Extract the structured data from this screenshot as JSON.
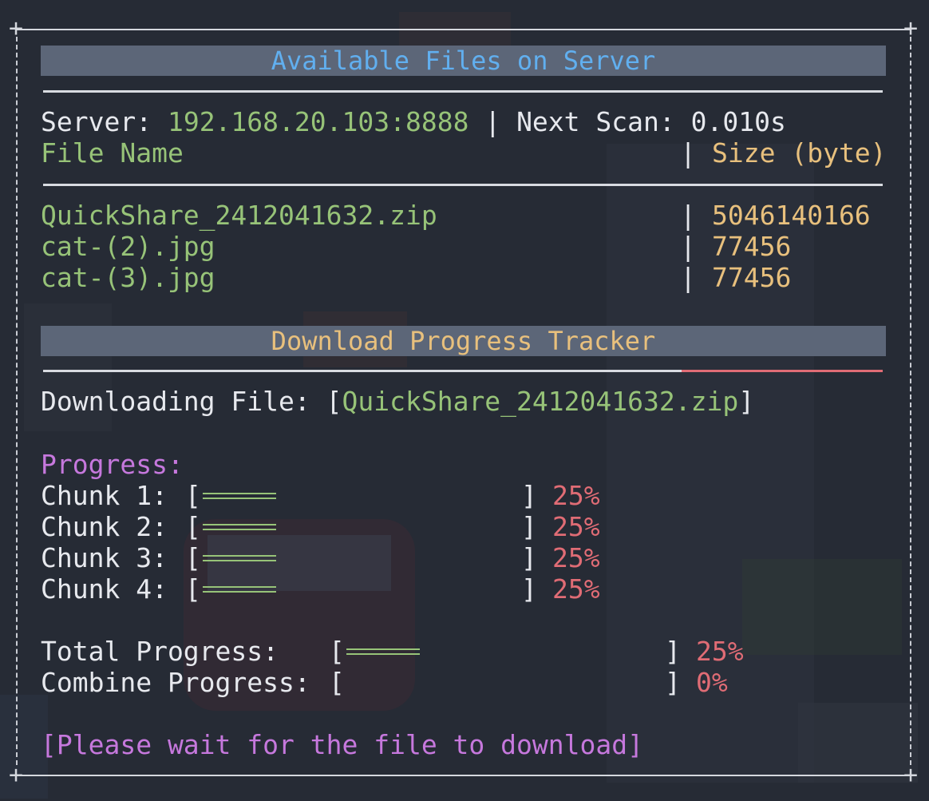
{
  "files_panel": {
    "title": "Available Files on Server",
    "server_label": "Server: ",
    "server_address": "192.168.20.103:8888",
    "separator": " | ",
    "next_scan_label": "Next Scan: ",
    "next_scan_value": "0.010s",
    "columns": {
      "name": "File Name",
      "size": "Size (byte)"
    },
    "column_separator": "|",
    "files": [
      {
        "name": "QuickShare_2412041632.zip",
        "size": "5046140166"
      },
      {
        "name": "cat-(2).jpg",
        "size": "77456"
      },
      {
        "name": "cat-(3).jpg",
        "size": "77456"
      }
    ]
  },
  "download_panel": {
    "title": "Download Progress Tracker",
    "header_progress_fraction": 0.76,
    "downloading_label": "Downloading File: ",
    "bracket_open": "[",
    "bracket_close": "]",
    "downloading_file": "QuickShare_2412041632.zip",
    "progress_heading": "Progress:",
    "chunks": [
      {
        "label": "Chunk 1:",
        "percent_text": "25%",
        "fraction": 0.25
      },
      {
        "label": "Chunk 2:",
        "percent_text": "25%",
        "fraction": 0.25
      },
      {
        "label": "Chunk 3:",
        "percent_text": "25%",
        "fraction": 0.25
      },
      {
        "label": "Chunk 4:",
        "percent_text": "25%",
        "fraction": 0.25
      }
    ],
    "total": {
      "label": "Total Progress:",
      "percent_text": "25%",
      "fraction": 0.25
    },
    "combine": {
      "label": "Combine Progress:",
      "percent_text": "0%",
      "fraction": 0
    },
    "status_message": "[Please wait for the file to download]"
  },
  "frame": {
    "corner_glyph": "+"
  },
  "colors": {
    "background": "#262b35",
    "header_bar": "#5c6678",
    "title_blue": "#61afef",
    "title_yellow": "#e8c07d",
    "file_green": "#97c378",
    "size_yellow": "#e8c07d",
    "percent_red": "#e06c75",
    "heading_purple": "#c678dd"
  }
}
